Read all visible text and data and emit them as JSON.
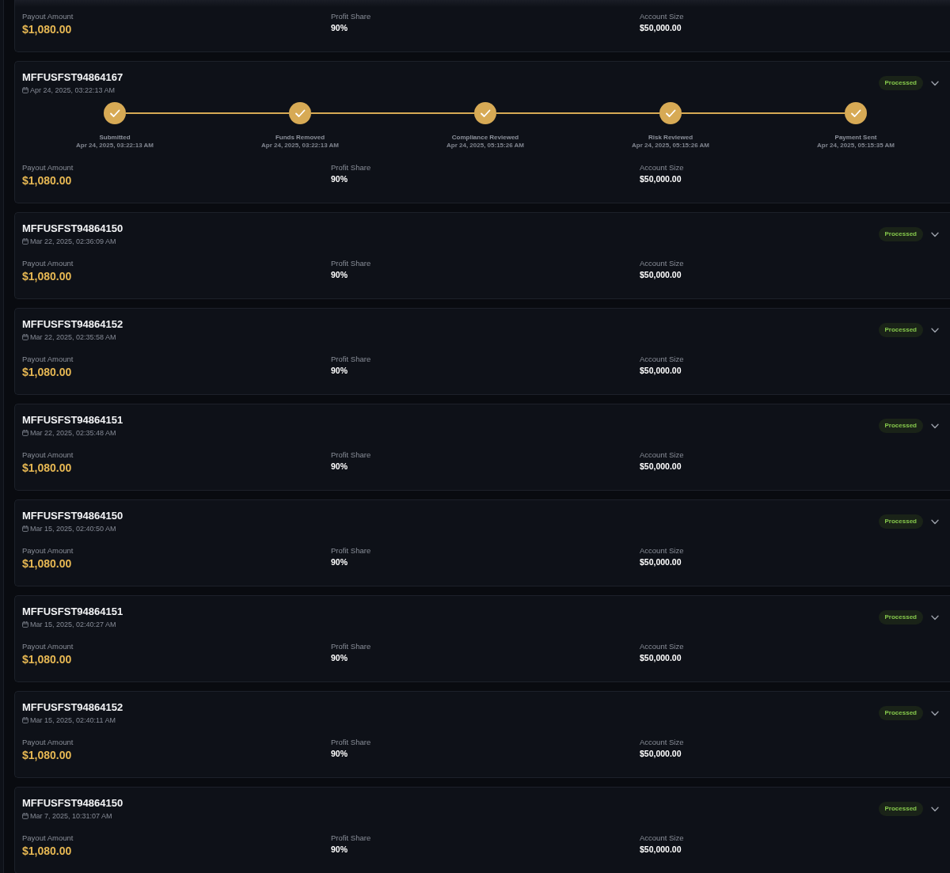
{
  "payouts": [
    {
      "stats": [
        {
          "label": "Payout Amount",
          "value": "$1,080.00",
          "kind": "amount"
        },
        {
          "label": "Profit Share",
          "value": "90%",
          "kind": "plain"
        },
        {
          "label": "Account Size",
          "value": "$50,000.00",
          "kind": "plain"
        }
      ]
    },
    {
      "id": "MFFUSFST94864167",
      "date": "Apr 24, 2025, 03:22:13 AM",
      "status": "Processed",
      "steps": [
        {
          "name": "Submitted",
          "date": "Apr 24, 2025, 03:22:13 AM",
          "done": true
        },
        {
          "name": "Funds Removed",
          "date": "Apr 24, 2025, 03:22:13 AM",
          "done": true
        },
        {
          "name": "Compliance Reviewed",
          "date": "Apr 24, 2025, 05:15:26 AM",
          "done": true
        },
        {
          "name": "Risk Reviewed",
          "date": "Apr 24, 2025, 05:15:26 AM",
          "done": true
        },
        {
          "name": "Payment Sent",
          "date": "Apr 24, 2025, 05:15:35 AM",
          "done": true
        }
      ],
      "stats": [
        {
          "label": "Payout Amount",
          "value": "$1,080.00",
          "kind": "amount"
        },
        {
          "label": "Profit Share",
          "value": "90%",
          "kind": "plain"
        },
        {
          "label": "Account Size",
          "value": "$50,000.00",
          "kind": "plain"
        }
      ]
    },
    {
      "id": "MFFUSFST94864150",
      "date": "Mar 22, 2025, 02:36:09 AM",
      "status": "Processed",
      "stats": [
        {
          "label": "Payout Amount",
          "value": "$1,080.00",
          "kind": "amount"
        },
        {
          "label": "Profit Share",
          "value": "90%",
          "kind": "plain"
        },
        {
          "label": "Account Size",
          "value": "$50,000.00",
          "kind": "plain"
        }
      ]
    },
    {
      "id": "MFFUSFST94864152",
      "date": "Mar 22, 2025, 02:35:58 AM",
      "status": "Processed",
      "stats": [
        {
          "label": "Payout Amount",
          "value": "$1,080.00",
          "kind": "amount"
        },
        {
          "label": "Profit Share",
          "value": "90%",
          "kind": "plain"
        },
        {
          "label": "Account Size",
          "value": "$50,000.00",
          "kind": "plain"
        }
      ]
    },
    {
      "id": "MFFUSFST94864151",
      "date": "Mar 22, 2025, 02:35:48 AM",
      "status": "Processed",
      "stats": [
        {
          "label": "Payout Amount",
          "value": "$1,080.00",
          "kind": "amount"
        },
        {
          "label": "Profit Share",
          "value": "90%",
          "kind": "plain"
        },
        {
          "label": "Account Size",
          "value": "$50,000.00",
          "kind": "plain"
        }
      ]
    },
    {
      "id": "MFFUSFST94864150",
      "date": "Mar 15, 2025, 02:40:50 AM",
      "status": "Processed",
      "stats": [
        {
          "label": "Payout Amount",
          "value": "$1,080.00",
          "kind": "amount"
        },
        {
          "label": "Profit Share",
          "value": "90%",
          "kind": "plain"
        },
        {
          "label": "Account Size",
          "value": "$50,000.00",
          "kind": "plain"
        }
      ]
    },
    {
      "id": "MFFUSFST94864151",
      "date": "Mar 15, 2025, 02:40:27 AM",
      "status": "Processed",
      "stats": [
        {
          "label": "Payout Amount",
          "value": "$1,080.00",
          "kind": "amount"
        },
        {
          "label": "Profit Share",
          "value": "90%",
          "kind": "plain"
        },
        {
          "label": "Account Size",
          "value": "$50,000.00",
          "kind": "plain"
        }
      ]
    },
    {
      "id": "MFFUSFST94864152",
      "date": "Mar 15, 2025, 02:40:11 AM",
      "status": "Processed",
      "stats": [
        {
          "label": "Payout Amount",
          "value": "$1,080.00",
          "kind": "amount"
        },
        {
          "label": "Profit Share",
          "value": "90%",
          "kind": "plain"
        },
        {
          "label": "Account Size",
          "value": "$50,000.00",
          "kind": "plain"
        }
      ]
    },
    {
      "id": "MFFUSFST94864150",
      "date": "Mar 7, 2025, 10:31:07 AM",
      "status": "Processed",
      "stats": [
        {
          "label": "Payout Amount",
          "value": "$1,080.00",
          "kind": "amount"
        },
        {
          "label": "Profit Share",
          "value": "90%",
          "kind": "plain"
        },
        {
          "label": "Account Size",
          "value": "$50,000.00",
          "kind": "plain"
        }
      ]
    }
  ]
}
